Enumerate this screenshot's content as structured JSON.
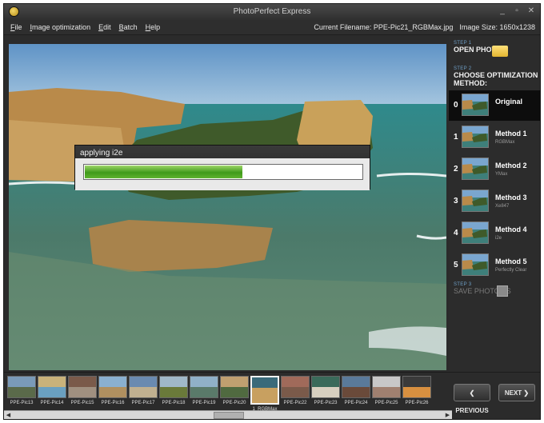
{
  "window": {
    "title": "PhotoPerfect Express",
    "controls": [
      "_",
      "▫",
      "✕"
    ]
  },
  "menu": {
    "items": [
      "File",
      "Image optimization",
      "Edit",
      "Batch",
      "Help"
    ]
  },
  "file_info": {
    "current_filename": "Current Filename: PPE-Pic21_RGBMax.jpg",
    "image_size": "Image Size: 1650x1238"
  },
  "progress": {
    "title": "applying i2e",
    "fraction": 0.57
  },
  "panel": {
    "step1": {
      "label": "STEP 1",
      "title": "OPEN PHOTO"
    },
    "step2": {
      "label": "STEP 2",
      "title": "CHOOSE OPTIMIZATION METHOD:"
    },
    "methods": [
      {
        "num": "0",
        "name": "Original",
        "sub": "",
        "active": true
      },
      {
        "num": "1",
        "name": "Method 1",
        "sub": "RGBMax",
        "active": false
      },
      {
        "num": "2",
        "name": "Method 2",
        "sub": "YMax",
        "active": false
      },
      {
        "num": "3",
        "name": "Method 3",
        "sub": "Xe847",
        "active": false
      },
      {
        "num": "4",
        "name": "Method 4",
        "sub": "i2e",
        "active": false
      },
      {
        "num": "5",
        "name": "Method 5",
        "sub": "Perfectly Clear",
        "active": false
      }
    ],
    "step3": {
      "label": "STEP 3",
      "title": "SAVE PHOTO AS"
    }
  },
  "filmstrip": {
    "items": [
      "PPE-Pic13",
      "PPE-Pic14",
      "PPE-Pic15",
      "PPE-Pic16",
      "PPE-Pic17",
      "PPE-Pic18",
      "PPE-Pic19",
      "PPE-Pic20",
      "1_RGBMax",
      "PPE-Pic22",
      "PPE-Pic23",
      "PPE-Pic24",
      "PPE-Pic25",
      "PPE-Pic26"
    ],
    "selected_index": 8,
    "previous_label": "PREVIOUS",
    "next_label": "NEXT",
    "previous_icon": "chevron-left-icon",
    "next_icon": "chevron-right-icon"
  },
  "colors": {
    "accent_green": "#4fa823",
    "panel_bg": "#2c2c2c",
    "step_label": "#6fa0c8"
  }
}
